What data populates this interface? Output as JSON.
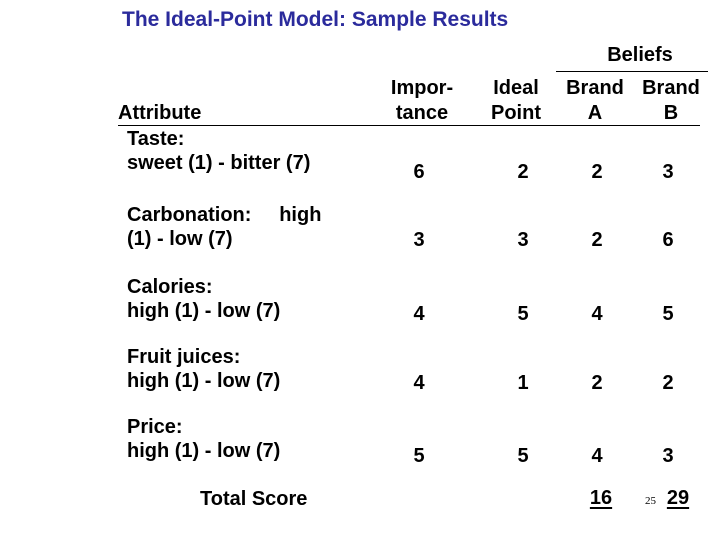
{
  "title": "The Ideal-Point Model: Sample Results",
  "header": {
    "group_label": "Beliefs",
    "attribute": "Attribute",
    "importance": [
      "Impor-",
      "tance"
    ],
    "ideal_point": [
      "Ideal",
      "Point"
    ],
    "brand_a": [
      "Brand",
      "A"
    ],
    "brand_b": [
      "Brand",
      "B"
    ]
  },
  "rows": [
    {
      "label": [
        "Taste:",
        "sweet (1) - bitter (7)"
      ],
      "importance": "6",
      "ideal": "2",
      "brand_a": "2",
      "brand_b": "3"
    },
    {
      "label": [
        "Carbonation:     high",
        "(1) - low (7)"
      ],
      "importance": "3",
      "ideal": "3",
      "brand_a": "2",
      "brand_b": "6"
    },
    {
      "label": [
        "Calories:",
        "high (1) - low (7)"
      ],
      "importance": "4",
      "ideal": "5",
      "brand_a": "4",
      "brand_b": "5"
    },
    {
      "label": [
        "Fruit juices:",
        "high (1) - low (7)"
      ],
      "importance": "4",
      "ideal": "1",
      "brand_a": "2",
      "brand_b": "2"
    },
    {
      "label": [
        "Price:",
        "high (1) - low (7)"
      ],
      "importance": "5",
      "ideal": "5",
      "brand_a": "4",
      "brand_b": "3"
    }
  ],
  "total": {
    "label": "Total Score",
    "brand_a": "16",
    "brand_b": "29"
  },
  "slide_number": "25"
}
